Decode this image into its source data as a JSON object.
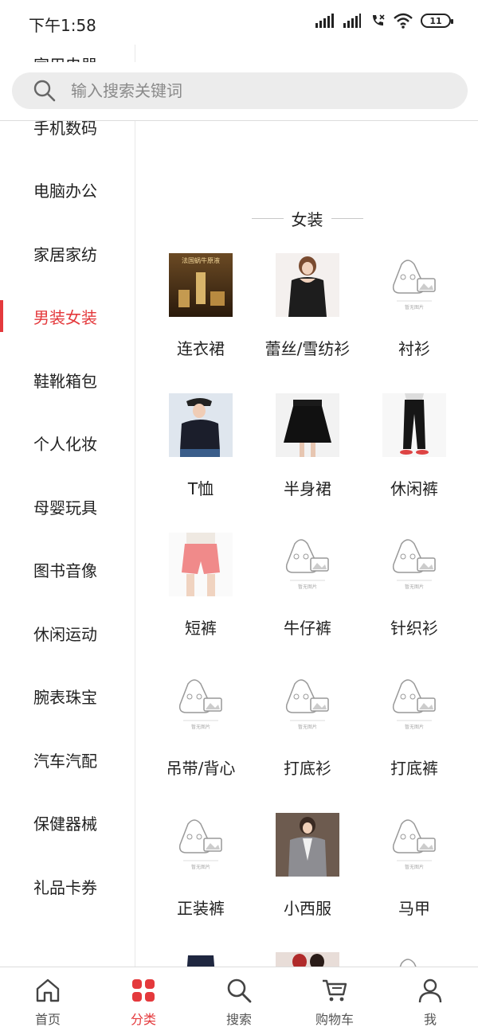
{
  "status_bar": {
    "time": "下午1:58",
    "battery": "11"
  },
  "search": {
    "placeholder": "输入搜索关键词"
  },
  "sidebar": {
    "items": [
      {
        "label": "家用电器",
        "active": false
      },
      {
        "label": "手机数码",
        "active": false
      },
      {
        "label": "电脑办公",
        "active": false
      },
      {
        "label": "家居家纺",
        "active": false
      },
      {
        "label": "男装女装",
        "active": true
      },
      {
        "label": "鞋靴箱包",
        "active": false
      },
      {
        "label": "个人化妆",
        "active": false
      },
      {
        "label": "母婴玩具",
        "active": false
      },
      {
        "label": "图书音像",
        "active": false
      },
      {
        "label": "休闲运动",
        "active": false
      },
      {
        "label": "腕表珠宝",
        "active": false
      },
      {
        "label": "汽车汽配",
        "active": false
      },
      {
        "label": "保健器械",
        "active": false
      },
      {
        "label": "礼品卡券",
        "active": false
      }
    ]
  },
  "section": {
    "title": "女装",
    "items": [
      {
        "label": "连衣裙",
        "image": "product-photo",
        "photo_text": "法国蜗牛原液"
      },
      {
        "label": "蕾丝/雪纺衫",
        "image": "product-photo"
      },
      {
        "label": "衬衫",
        "image": "placeholder"
      },
      {
        "label": "T恤",
        "image": "product-photo"
      },
      {
        "label": "半身裙",
        "image": "product-photo"
      },
      {
        "label": "休闲裤",
        "image": "product-photo"
      },
      {
        "label": "短裤",
        "image": "product-photo"
      },
      {
        "label": "牛仔裤",
        "image": "placeholder"
      },
      {
        "label": "针织衫",
        "image": "placeholder"
      },
      {
        "label": "吊带/背心",
        "image": "placeholder"
      },
      {
        "label": "打底衫",
        "image": "placeholder"
      },
      {
        "label": "打底裤",
        "image": "placeholder"
      },
      {
        "label": "正装裤",
        "image": "placeholder"
      },
      {
        "label": "小西服",
        "image": "product-photo"
      },
      {
        "label": "马甲",
        "image": "placeholder"
      }
    ],
    "placeholder_text": "暂无图片"
  },
  "tabbar": {
    "tabs": [
      {
        "label": "首页",
        "icon": "home-icon"
      },
      {
        "label": "分类",
        "icon": "category-icon",
        "active": true
      },
      {
        "label": "搜索",
        "icon": "search-icon"
      },
      {
        "label": "购物车",
        "icon": "cart-icon"
      },
      {
        "label": "我",
        "icon": "user-icon"
      }
    ]
  },
  "colors": {
    "accent": "#e4393c",
    "search_bg": "#ececec"
  }
}
